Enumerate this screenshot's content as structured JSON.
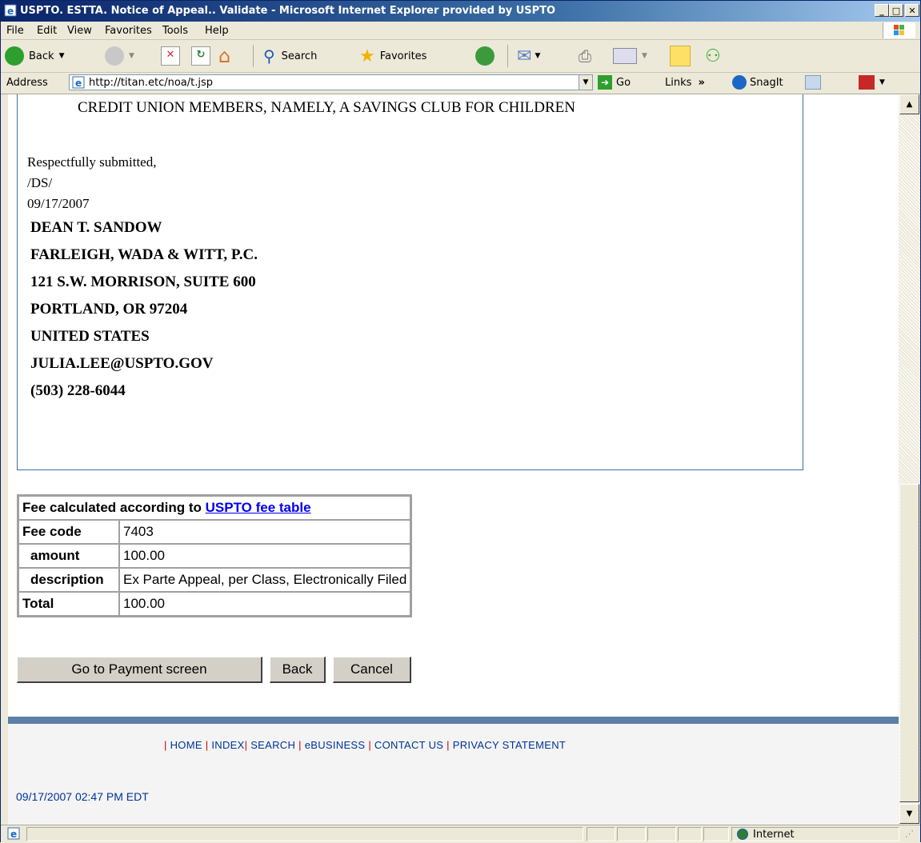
{
  "window": {
    "title": "USPTO. ESTTA. Notice of Appeal.. Validate - Microsoft Internet Explorer provided by USPTO",
    "minimize": "_",
    "maximize": "□",
    "close": "✕"
  },
  "menu": [
    "File",
    "Edit",
    "View",
    "Favorites",
    "Tools",
    "Help"
  ],
  "toolbar": {
    "back": "Back",
    "search": "Search",
    "favorites": "Favorites"
  },
  "address": {
    "label": "Address",
    "url": "http://titan.etc/noa/t.jsp",
    "go": "Go",
    "links": "Links",
    "chevron": "»",
    "snagit": "SnagIt"
  },
  "document": {
    "goods": "CREDIT UNION MEMBERS, NAMELY, A SAVINGS CLUB FOR CHILDREN",
    "closing": "Respectfully submitted,",
    "signature": "/DS/",
    "date": "09/17/2007",
    "attorney": "DEAN T. SANDOW",
    "firm": "FARLEIGH, WADA & WITT, P.C.",
    "street": "121 S.W. MORRISON, SUITE 600",
    "city": "PORTLAND, OR 97204",
    "country": "UNITED STATES",
    "email": "JULIA.LEE@USPTO.GOV",
    "phone": "(503) 228-6044"
  },
  "fee": {
    "header_text": "Fee calculated according to ",
    "header_link": "USPTO fee table",
    "rows": [
      {
        "label": "Fee code",
        "value": "7403"
      },
      {
        "label": "amount",
        "value": "100.00"
      },
      {
        "label": "description",
        "value": "Ex Parte Appeal, per Class, Electronically Filed"
      },
      {
        "label": "Total",
        "value": "100.00"
      }
    ]
  },
  "buttons": {
    "payment": "Go to Payment screen",
    "back": "Back",
    "cancel": "Cancel"
  },
  "footer": {
    "links": [
      "HOME",
      "INDEX",
      "SEARCH",
      "eBUSINESS",
      "CONTACT US",
      "PRIVACY STATEMENT"
    ],
    "timestamp": "09/17/2007 02:47 PM EDT"
  },
  "status": {
    "zone": "Internet"
  }
}
